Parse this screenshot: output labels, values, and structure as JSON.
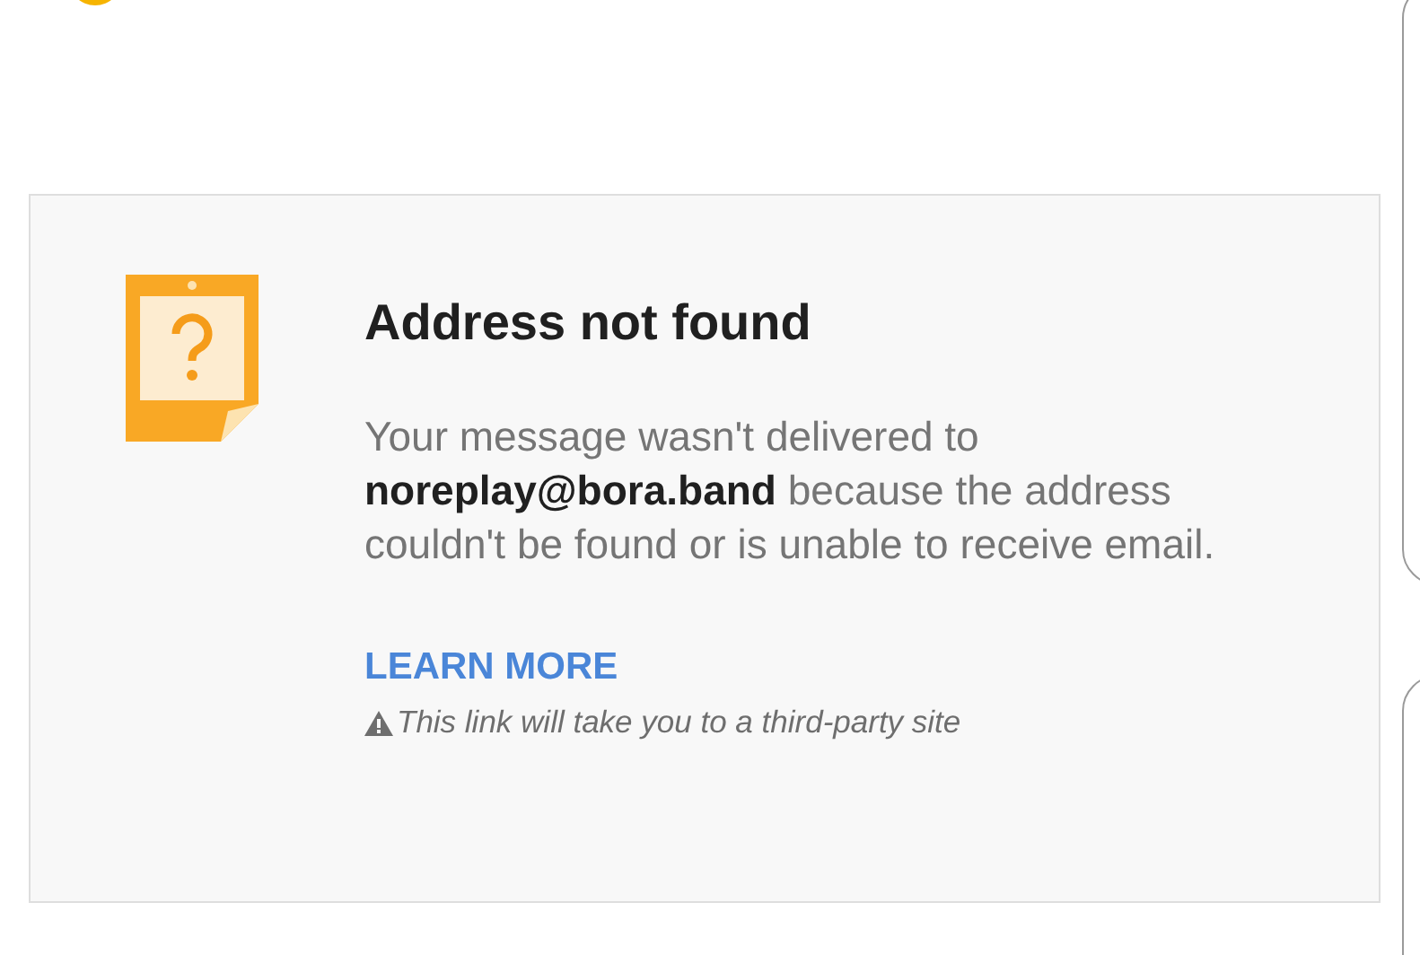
{
  "notice": {
    "title": "Address not found",
    "message": "Your message wasn't delivered to **noreplay@bora.band** because the address couldn't be found or is unable to receive email.",
    "link": "LEARN MORE",
    "warning": "This link will take you to a third-party site"
  }
}
